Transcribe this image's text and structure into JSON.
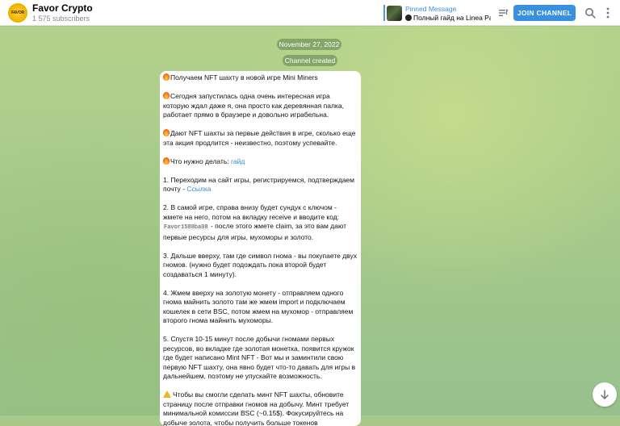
{
  "channel": {
    "title": "Favor Crypto",
    "subscribers": "1 575 subscribers",
    "avatar_text": "FAVOR"
  },
  "pinned": {
    "label": "Pinned Message",
    "text": "Полный гайд на Linea Park"
  },
  "header": {
    "join_label": "JOIN CHANNEL",
    "icons": [
      "pinned-list-icon",
      "search-icon",
      "more-vertical-icon"
    ]
  },
  "chat": {
    "date": "November 27, 2022",
    "service": "Channel created"
  },
  "message": {
    "p1": "Получаем NFT шахту в новой игре Mini Miners",
    "p2": "Сегодня запустилась одна очень интересная игра которую ждал даже я, она просто как деревянная палка, работает прямо в браузере и довольно играбельна.",
    "p3": "Дают NFT шахты за первые действия в игре, сколько еще эта акция продлится - неизвестно, поэтому успевайте.",
    "p4_text": "Что нужно делать: ",
    "p4_link": "гайд",
    "p5_text": "1. Переходим на сайт игры, регистрируемся, подтверждаем почту - ",
    "p5_link": "Ссылка",
    "p6_a": "2. В самой игре, справа внизу будет сундук с ключом - жмете на него, потом на вкладку receive и вводите код: ",
    "p6_code": "Favor1588ba08",
    "p6_b": " - после этого жмете claim, за это вам дают первые ресурсы для игры, мухоморы и золото.",
    "p7": "3. Дальше вверху, там где символ гнома - вы покупаете двух гномов. (нужно будет подождать пока второй будет создаваться 1 минуту).",
    "p8": "4. Жмем вверху на золотую монету - отправляем одного гнома майнить золото там же жмем import и подключаем кошелек в сети BSC, потом жмем на мухомор - отправляем второго гнома майнить мухоморы.",
    "p9": "5. Спустя 10-15 минут после добычи гномами первых ресурсов, во вкладке где золотая монетка, появится кружок где будет написано Mint NFT - Вот мы и заминтили свою первую NFT шахту, она явно будет что-то давать для игры в дальнейшем, поэтому не упускайте возможность.",
    "p10": "Чтобы вы смогли сделать минт NFT шахты, обновите страницу после отправки гномов на добычу. Минт требует минимальной комиссии BSC (~0.15$). Фокусируйтесь на добыче золота, чтобы получить больше токенов"
  },
  "colors": {
    "accent": "#3a90e0",
    "link": "#2f8fe0",
    "background": "#a8c98a"
  }
}
